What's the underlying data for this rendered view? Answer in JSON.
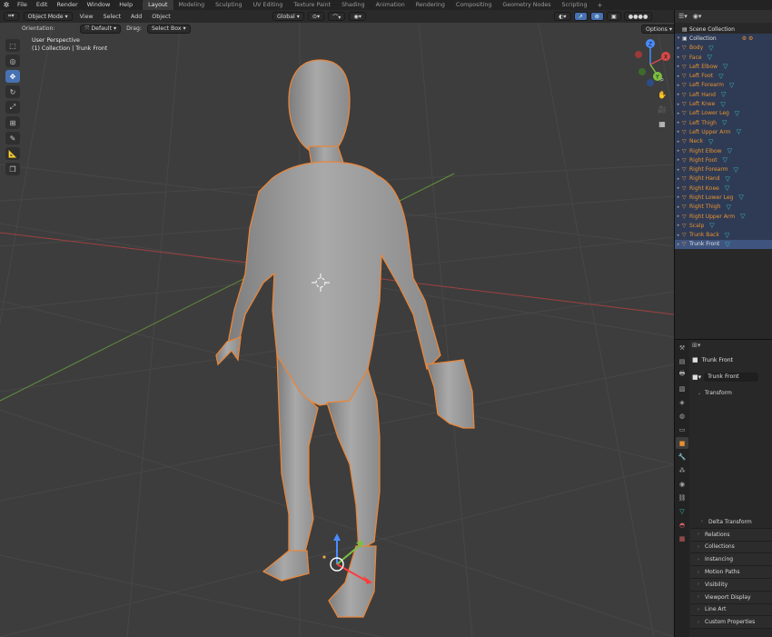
{
  "topbar": {
    "menus": [
      "File",
      "Edit",
      "Render",
      "Window",
      "Help"
    ],
    "workspaces": [
      "Layout",
      "Modeling",
      "Sculpting",
      "UV Editing",
      "Texture Paint",
      "Shading",
      "Animation",
      "Rendering",
      "Compositing",
      "Geometry Nodes",
      "Scripting"
    ],
    "active_workspace": "Layout",
    "add_tab": "+"
  },
  "viewport_header": {
    "mode": "Object Mode",
    "menus": [
      "View",
      "Select",
      "Add",
      "Object"
    ],
    "transform_orientation": "Global"
  },
  "tool_settings": {
    "orientation_label": "Orientation:",
    "orientation_value": "Default",
    "drag_label": "Drag:",
    "drag_value": "Select Box",
    "options": "Options"
  },
  "overlay": {
    "view_name": "User Perspective",
    "collection_info": "(1) Collection | Trunk Front"
  },
  "gizmo_axes": {
    "x": "X",
    "y": "Y",
    "z": "Z"
  },
  "outliner": {
    "scene_collection": "Scene Collection",
    "collection": "Collection",
    "items": [
      "Body",
      "Face",
      "Left Elbow",
      "Left Foot",
      "Left Forearm",
      "Left Hand",
      "Left Knee",
      "Left Lower Leg",
      "Left Thigh",
      "Left Upper Arm",
      "Neck",
      "Right Elbow",
      "Right Foot",
      "Right Forearm",
      "Right Hand",
      "Right Knee",
      "Right Lower Leg",
      "Right Thigh",
      "Right Upper Arm",
      "Scalp",
      "Trunk Back",
      "Trunk Front"
    ],
    "active_item": "Trunk Front"
  },
  "properties": {
    "object_name": "Trunk Front",
    "object_datablock": "Trunk Front",
    "transform_section": "Transform",
    "sections": [
      "Delta Transform",
      "Relations",
      "Collections",
      "Instancing",
      "Motion Paths",
      "Visibility",
      "Viewport Display",
      "Line Art",
      "Custom Properties"
    ]
  },
  "colors": {
    "accent_blue": "#4772b3",
    "selection_orange": "#e8922f",
    "viewport_bg": "#3d3d3d",
    "axis_red": "#c04848",
    "axis_green": "#6ea03a"
  }
}
